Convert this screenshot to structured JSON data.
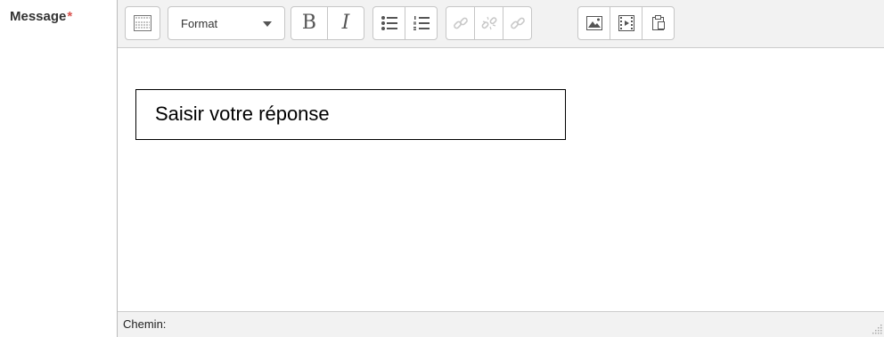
{
  "field": {
    "label": "Message",
    "required_marker": "*"
  },
  "toolbar": {
    "toggle_icon": "toolbar-toggle-icon",
    "format_select": {
      "selected": "Format"
    },
    "bold_glyph": "B",
    "italic_glyph": "I",
    "buttons": {
      "unordered_list": "unordered-list-icon",
      "ordered_list": "ordered-list-icon",
      "link": "link-icon",
      "unlink": "unlink-icon",
      "anchor": "anchor-icon",
      "image": "image-icon",
      "media": "media-icon",
      "paste": "paste-icon"
    }
  },
  "editor": {
    "content_text": "Saisir votre réponse"
  },
  "statusbar": {
    "path_label": "Chemin:"
  },
  "colors": {
    "required": "#d9534f",
    "toolbar_bg": "#f2f2f2",
    "border": "#c6c6c6"
  }
}
